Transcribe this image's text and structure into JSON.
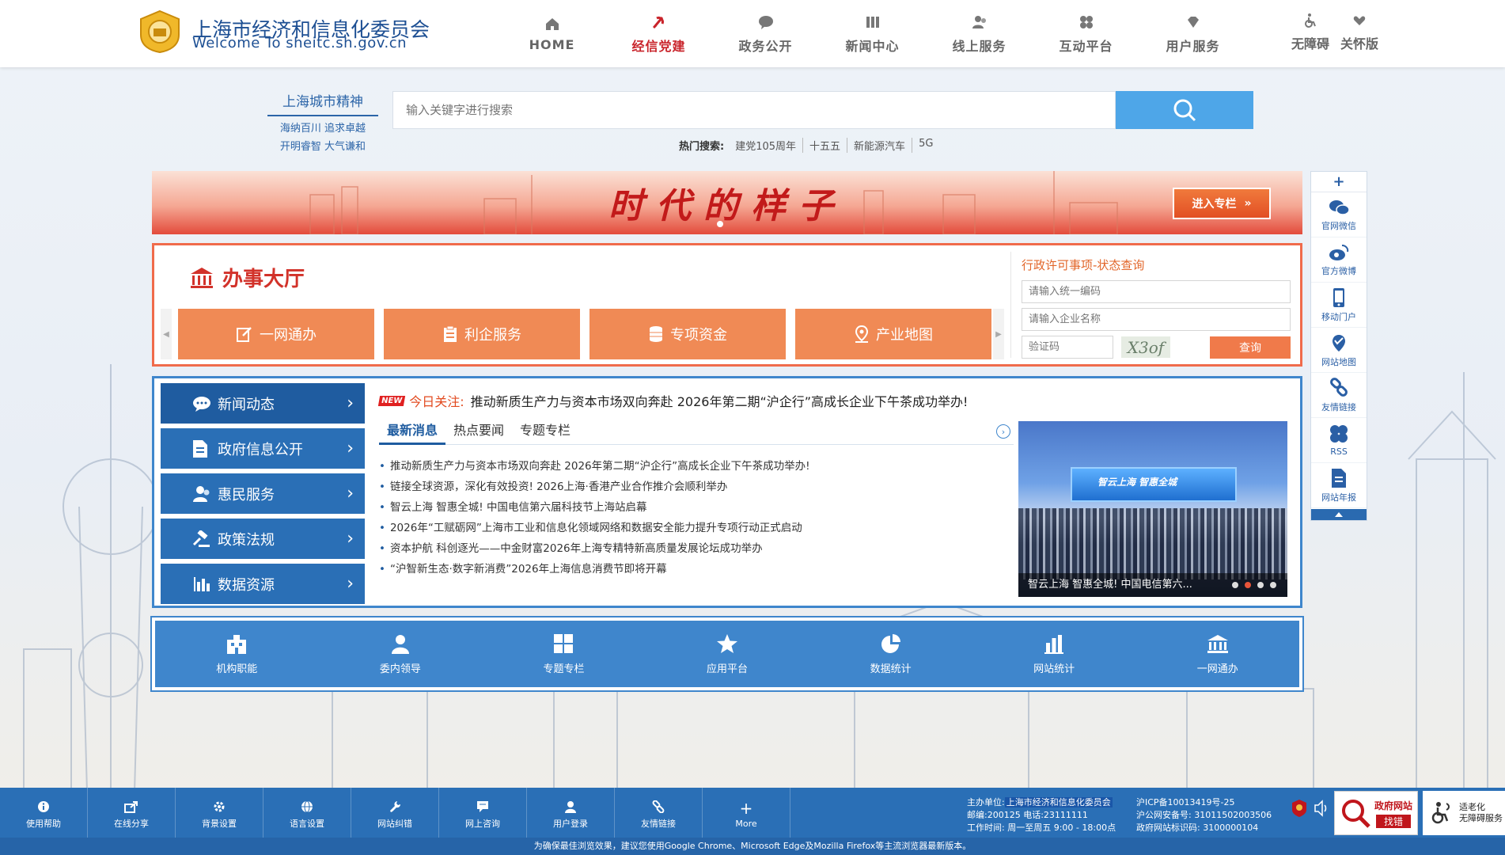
{
  "header": {
    "title": "上海市经济和信息化委员会",
    "subtitle": "Welcome To sheitc.sh.gov.cn",
    "nav": [
      {
        "label": "HOME",
        "icon": "home-icon"
      },
      {
        "label": "经信党建",
        "icon": "party-emblem-icon",
        "active": true
      },
      {
        "label": "政务公开",
        "icon": "chat-bubble-icon"
      },
      {
        "label": "新闻中心",
        "icon": "columns-icon"
      },
      {
        "label": "线上服务",
        "icon": "people-icon"
      },
      {
        "label": "互动平台",
        "icon": "grid-dots-icon"
      },
      {
        "label": "用户服务",
        "icon": "gem-icon"
      }
    ],
    "accessibility": "无障碍",
    "care": "关怀版"
  },
  "spirit": {
    "title": "上海城市精神",
    "line1": "海纳百川  追求卓越",
    "line2": "开明睿智  大气谦和"
  },
  "search": {
    "placeholder": "输入关键字进行搜索",
    "hot_label": "热门搜索:",
    "hot_terms": [
      "建党105周年",
      "十五五",
      "新能源汽车",
      "5G"
    ]
  },
  "banner": {
    "text": "时代的样子",
    "button": "进入专栏"
  },
  "sidebar": {
    "items": [
      {
        "label": "官网微信",
        "icon": "wechat-icon"
      },
      {
        "label": "官方微博",
        "icon": "weibo-icon"
      },
      {
        "label": "移动门户",
        "icon": "mobile-icon"
      },
      {
        "label": "网站地图",
        "icon": "map-pin-icon"
      },
      {
        "label": "友情链接",
        "icon": "link-icon"
      },
      {
        "label": "RSS",
        "icon": "rss-icon"
      },
      {
        "label": "网站年报",
        "icon": "report-icon"
      }
    ]
  },
  "hall": {
    "title": "办事大厅",
    "buttons": [
      "一网通办",
      "利企服务",
      "专项资金",
      "产业地图"
    ]
  },
  "query": {
    "title": "行政许可事项-状态查询",
    "code_placeholder": "请输入统一编码",
    "name_placeholder": "请输入企业名称",
    "captcha_placeholder": "验证码",
    "captcha_text": "X3of",
    "button": "查询"
  },
  "news": {
    "menu": [
      "新闻动态",
      "政府信息公开",
      "惠民服务",
      "政策法规",
      "数据资源"
    ],
    "today_badge": "NEW",
    "today_label": "今日关注:",
    "today_text": "推动新质生产力与资本市场双向奔赴 2026年第二期“沪企行”高成长企业下午茶成功举办!",
    "tabs": [
      "最新消息",
      "热点要闻",
      "专题专栏"
    ],
    "items": [
      "推动新质生产力与资本市场双向奔赴 2026年第二期“沪企行”高成长企业下午茶成功举办!",
      "链接全球资源，深化有效投资! 2026上海·香港产业合作推介会顺利举办",
      "智云上海 智惠全城! 中国电信第六届科技节上海站启幕",
      "2026年“工赋砺网”上海市工业和信息化领域网络和数据安全能力提升专项行动正式启动",
      "资本护航 科创逐光——中金财富2026年上海专精特新高质量发展论坛成功举办",
      "“沪智新生态·数字新消费”2026年上海信息消费节即将开幕"
    ],
    "photo_caption": "智云上海 智惠全城! 中国电信第六...",
    "photo_stage_text": "智云上海 智惠全城"
  },
  "quick": [
    {
      "label": "机构职能",
      "icon": "building-icon"
    },
    {
      "label": "委内领导",
      "icon": "person-icon"
    },
    {
      "label": "专题专栏",
      "icon": "tiles-icon"
    },
    {
      "label": "应用平台",
      "icon": "star-icon"
    },
    {
      "label": "数据统计",
      "icon": "pie-chart-icon"
    },
    {
      "label": "网站统计",
      "icon": "bar-chart-icon"
    },
    {
      "label": "一网通办",
      "icon": "bank-icon"
    }
  ],
  "footer": {
    "tools": [
      {
        "label": "使用帮助",
        "icon": "info-icon"
      },
      {
        "label": "在线分享",
        "icon": "share-icon"
      },
      {
        "label": "背景设置",
        "icon": "gear-icon"
      },
      {
        "label": "语言设置",
        "icon": "globe-icon"
      },
      {
        "label": "网站纠错",
        "icon": "wrench-icon"
      },
      {
        "label": "网上咨询",
        "icon": "message-icon"
      },
      {
        "label": "用户登录",
        "icon": "user-icon"
      },
      {
        "label": "友情链接",
        "icon": "link-icon"
      },
      {
        "label": "More",
        "icon": "plus-icon"
      }
    ],
    "host_label": "主办单位:",
    "host": "上海市经济和信息化委员会",
    "postal": "邮编:200125 电话:23111111",
    "hours": "工作时间: 周一至周五 9:00 - 18:00点",
    "icp": "沪ICP备10013419号-25",
    "police": "沪公网安备号: 31011502003506",
    "site_code": "政府网站标识码: 3100000104",
    "gov_badge_line1": "政府网站",
    "gov_badge_line2": "找错",
    "elder_line1": "适老化",
    "elder_line2": "无障碍服务",
    "note": "为确保最佳浏览效果，建议您使用Google Chrome、Microsoft Edge及Mozilla Firefox等主流浏览器最新版本。"
  }
}
